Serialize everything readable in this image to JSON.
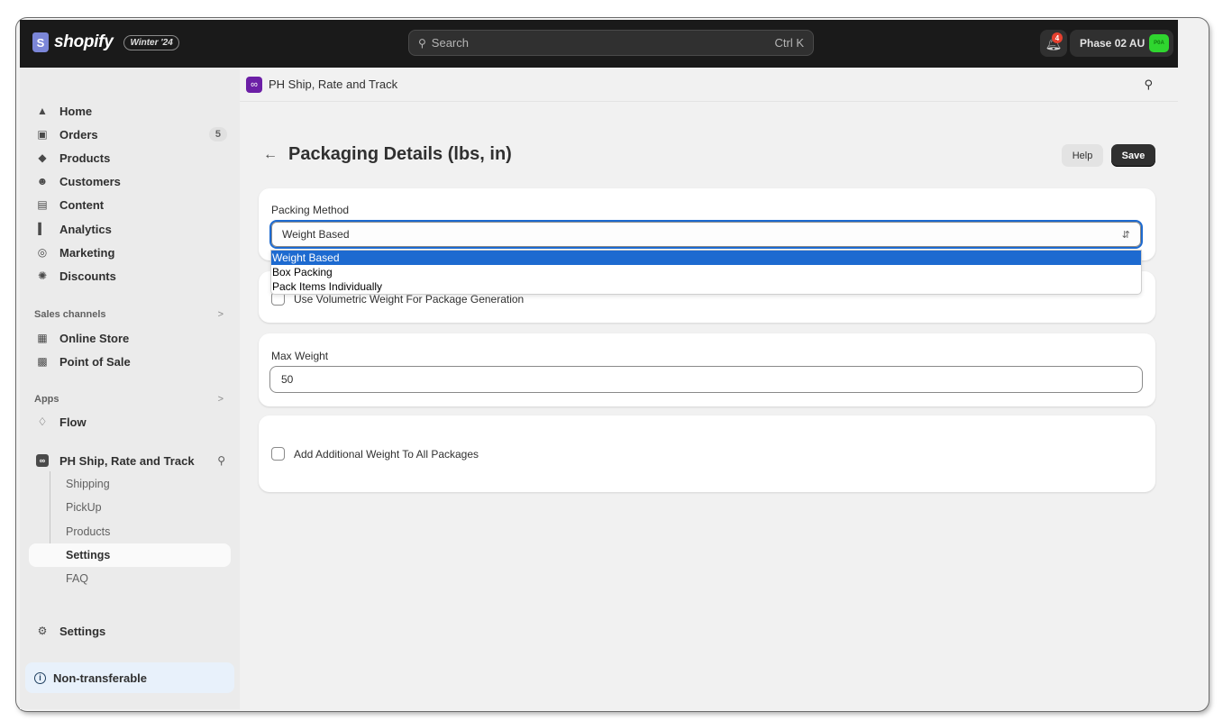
{
  "topbar": {
    "brand": "shopify",
    "edition_badge": "Winter '24",
    "search_placeholder": "Search",
    "search_shortcut": "Ctrl K",
    "notification_count": "4",
    "store_name": "Phase 02 AU",
    "store_avatar": "P0A",
    "avatar_color": "#2fd62f"
  },
  "sidebar": {
    "items": [
      {
        "label": "Home",
        "icon": "home-icon"
      },
      {
        "label": "Orders",
        "icon": "inbox-icon",
        "count": "5"
      },
      {
        "label": "Products",
        "icon": "tag-icon"
      },
      {
        "label": "Customers",
        "icon": "person-icon"
      },
      {
        "label": "Content",
        "icon": "content-icon"
      },
      {
        "label": "Analytics",
        "icon": "bar-chart-icon"
      },
      {
        "label": "Marketing",
        "icon": "target-icon"
      },
      {
        "label": "Discounts",
        "icon": "discount-icon"
      }
    ],
    "sales_channels_label": "Sales channels",
    "sales_channels": [
      {
        "label": "Online Store",
        "icon": "store-icon"
      },
      {
        "label": "Point of Sale",
        "icon": "pos-icon"
      }
    ],
    "apps_label": "Apps",
    "apps": [
      {
        "label": "Flow",
        "icon": "flow-icon"
      }
    ],
    "pinned_app": {
      "label": "PH Ship, Rate and Track",
      "subitems": [
        "Shipping",
        "PickUp",
        "Products",
        "Settings",
        "FAQ"
      ],
      "active_subitem": "Settings"
    },
    "settings_label": "Settings",
    "non_transferable_label": "Non-transferable"
  },
  "appbar": {
    "title": "PH Ship, Rate and Track",
    "brand_color": "#6c1fa6"
  },
  "page": {
    "title": "Packaging Details (lbs, in)",
    "help_label": "Help",
    "save_label": "Save"
  },
  "packing_method": {
    "label": "Packing Method",
    "value": "Weight Based",
    "options": [
      "Weight Based",
      "Box Packing",
      "Pack Items Individually"
    ],
    "selected_index": 0
  },
  "volumetric": {
    "label": "Use Volumetric Weight For Package Generation",
    "checked": false
  },
  "max_weight": {
    "label": "Max Weight",
    "value": "50"
  },
  "additional_weight": {
    "label": "Add Additional Weight To All Packages",
    "checked": false
  },
  "colors": {
    "accent": "#1d6ad0",
    "topbar": "#1a1a1a",
    "save_button": "#303030"
  }
}
